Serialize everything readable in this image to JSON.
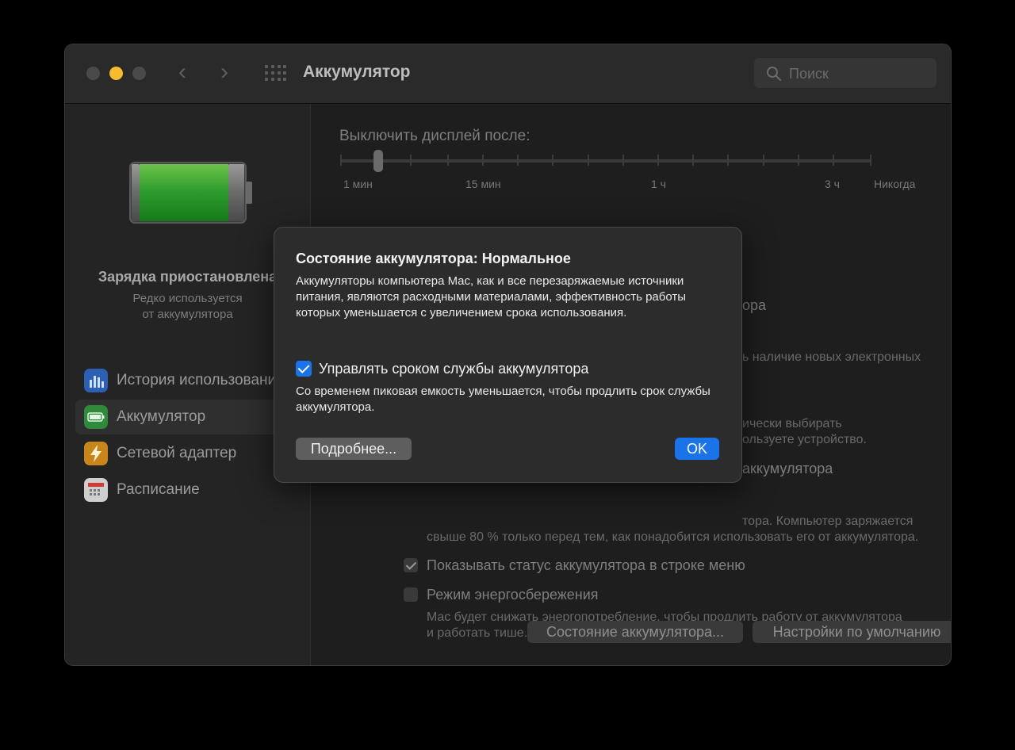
{
  "window": {
    "title": "Аккумулятор",
    "search_placeholder": "Поиск"
  },
  "sidebar": {
    "status": "Зарядка приостановлена",
    "status_sub_line1": "Редко используется",
    "status_sub_line2": "от аккумулятора",
    "items": [
      {
        "label": "История использования",
        "icon": "bar-chart-icon",
        "color": "#2f6fd6"
      },
      {
        "label": "Аккумулятор",
        "icon": "battery-icon",
        "color": "#34a853",
        "selected": true
      },
      {
        "label": "Сетевой адаптер",
        "icon": "lightning-icon",
        "color": "#e8a21a"
      },
      {
        "label": "Расписание",
        "icon": "calendar-icon",
        "color": "#d9d9d9"
      }
    ]
  },
  "content": {
    "display_off_label": "Выключить дисплей после:",
    "slider_value": "1 мин",
    "ticks": [
      "1 мин",
      "15 мин",
      "1 ч",
      "3 ч",
      "Никогда"
    ],
    "partial_right_1": "ора",
    "partial_right_2": "ь наличие новых электронных",
    "partial_right_3": "ически выбирать",
    "partial_right_4": "ользуете устройство.",
    "partial_right_5": "аккумулятора",
    "optimized_desc_line1_tail": "тора. Компьютер заряжается",
    "optimized_desc_line2": "свыше 80 % только перед тем, как понадобится использовать его от аккумулятора.",
    "show_status_label": "Показывать статус аккумулятора в строке меню",
    "show_status_checked": true,
    "low_power_label": "Режим энергосбережения",
    "low_power_checked": false,
    "low_power_desc_line1": "Mac будет снижать энергопотребление, чтобы продлить работу от аккумулятора",
    "low_power_desc_line2": "и работать тише.",
    "battery_health_button": "Состояние аккумулятора...",
    "defaults_button": "Настройки по умолчанию",
    "help": "?"
  },
  "dialog": {
    "title": "Состояние аккумулятора: Нормальное",
    "body": "Аккумуляторы компьютера Mac, как и все перезаряжаемые источники питания, являются расходными материалами, эффективность работы которых уменьшается с увеличением срока использования.",
    "manage_label": "Управлять сроком службы аккумулятора",
    "manage_checked": true,
    "manage_desc": "Со временем пиковая емкость уменьшается, чтобы продлить срок службы аккумулятора.",
    "more_button": "Подробнее...",
    "ok_button": "OK"
  }
}
